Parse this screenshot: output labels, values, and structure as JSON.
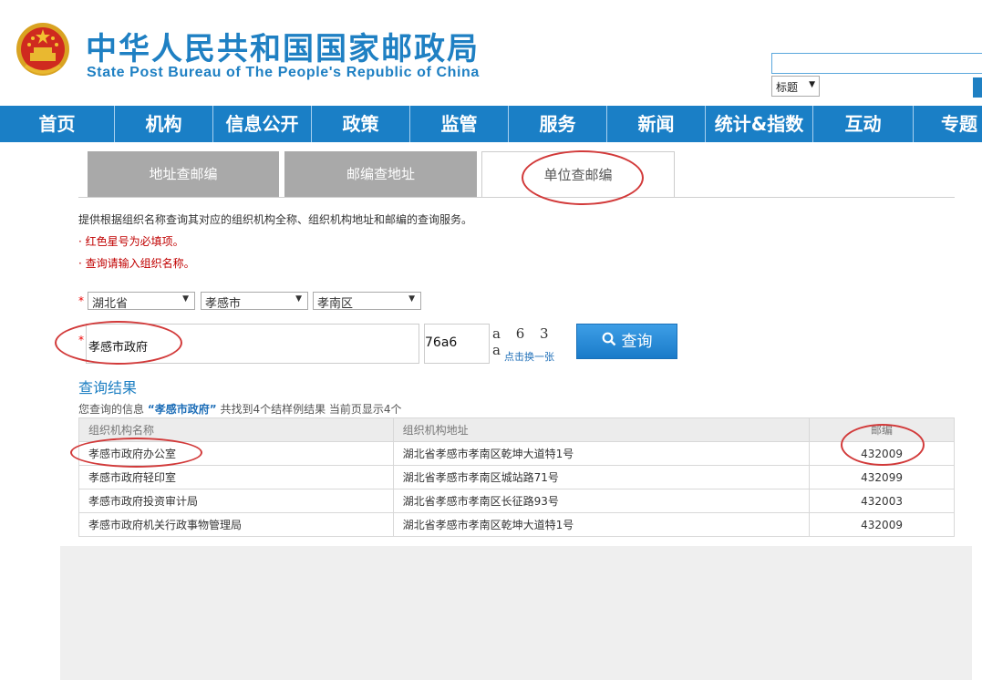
{
  "header": {
    "title_cn": "中华人民共和国国家邮政局",
    "title_en": "State Post Bureau of The People's Republic of China",
    "search_select": "标题"
  },
  "nav": [
    "首页",
    "机构",
    "信息公开",
    "政策",
    "监管",
    "服务",
    "新闻",
    "统计&指数",
    "互动",
    "专题"
  ],
  "tabs": [
    "地址查邮编",
    "邮编查地址",
    "单位查邮编"
  ],
  "intro": "提供根据组织名称查询其对应的组织机构全称、组织机构地址和邮编的查询服务。",
  "notes": [
    "红色星号为必填项。",
    "查询请输入组织名称。"
  ],
  "required_mark": "*",
  "filters": {
    "province": "湖北省",
    "city": "孝感市",
    "district": "孝南区"
  },
  "org_input_value": "孝感市政府",
  "code_input_value": "76a6",
  "captcha_text": "a 6 3 a",
  "captcha_refresh": "点击换一张",
  "query_button": "查询",
  "results": {
    "title": "查询结果",
    "summary_prefix": "您查询的信息",
    "summary_keyword": "“孝感市政府”",
    "summary_suffix": "共找到4个结样例结果  当前页显示4个",
    "headers": [
      "组织机构名称",
      "组织机构地址",
      "邮编"
    ],
    "rows": [
      [
        "孝感市政府办公室",
        "湖北省孝感市孝南区乾坤大道特1号",
        "432009"
      ],
      [
        "孝感市政府轻印室",
        "湖北省孝感市孝南区城站路71号",
        "432099"
      ],
      [
        "孝感市政府投资审计局",
        "湖北省孝感市孝南区长征路93号",
        "432003"
      ],
      [
        "孝感市政府机关行政事物管理局",
        "湖北省孝感市孝南区乾坤大道特1号",
        "432009"
      ]
    ]
  },
  "colors": {
    "brand_blue": "#1f80c3",
    "nav_blue": "#1a7fc6",
    "annotation_red": "#d23a3a"
  }
}
